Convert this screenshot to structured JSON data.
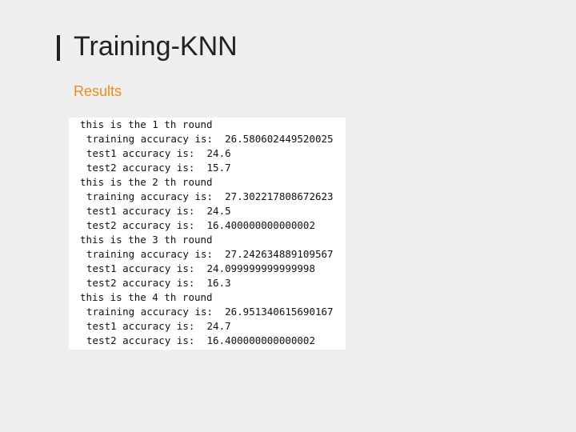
{
  "slide": {
    "title": "Training-KNN",
    "subtitle": "Results",
    "colors": {
      "background": "#efefef",
      "title": "#222222",
      "accent": "#ee8a1c",
      "console_bg": "#ffffff"
    }
  },
  "console": {
    "lines": [
      {
        "text": "this is the 1 th round",
        "indent": false
      },
      {
        "text": "training accuracy is:  26.580602449520025",
        "indent": true
      },
      {
        "text": "test1 accuracy is:  24.6",
        "indent": true
      },
      {
        "text": "test2 accuracy is:  15.7",
        "indent": true
      },
      {
        "text": "this is the 2 th round",
        "indent": false
      },
      {
        "text": "training accuracy is:  27.302217808672623",
        "indent": true
      },
      {
        "text": "test1 accuracy is:  24.5",
        "indent": true
      },
      {
        "text": "test2 accuracy is:  16.400000000000002",
        "indent": true
      },
      {
        "text": "this is the 3 th round",
        "indent": false
      },
      {
        "text": "training accuracy is:  27.242634889109567",
        "indent": true
      },
      {
        "text": "test1 accuracy is:  24.099999999999998",
        "indent": true
      },
      {
        "text": "test2 accuracy is:  16.3",
        "indent": true
      },
      {
        "text": "this is the 4 th round",
        "indent": false
      },
      {
        "text": "training accuracy is:  26.951340615690167",
        "indent": true
      },
      {
        "text": "test1 accuracy is:  24.7",
        "indent": true
      },
      {
        "text": "test2 accuracy is:  16.400000000000002",
        "indent": true
      }
    ]
  }
}
